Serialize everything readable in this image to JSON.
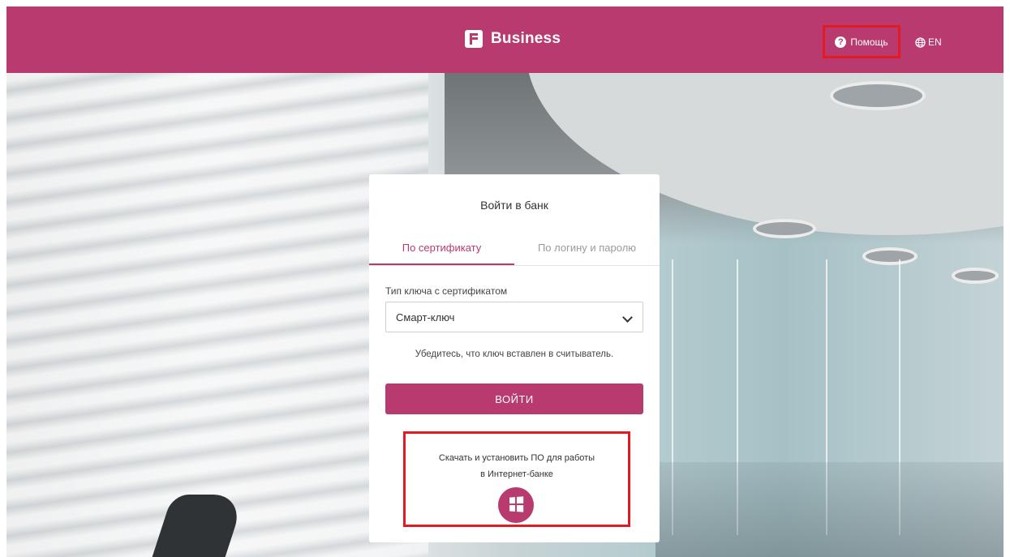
{
  "header": {
    "brand": "Business",
    "help_label": "Помощь",
    "lang_label": "EN"
  },
  "login": {
    "title": "Войти в банк",
    "tabs": [
      {
        "label": "По сертификату",
        "active": true
      },
      {
        "label": "По логину и паролю",
        "active": false
      }
    ],
    "key_type_label": "Тип ключа с сертификатом",
    "key_type_value": "Смарт-ключ",
    "hint": "Убедитесь, что ключ вставлен в считыватель.",
    "submit_label": "ВОЙТИ",
    "download_line1": "Скачать и установить ПО для работы",
    "download_line2": "в Интернет-банке"
  },
  "icons": {
    "logo": "brand-f-icon",
    "help": "question-circle-icon",
    "language": "globe-icon",
    "dropdown": "chevron-down-icon",
    "download": "windows-icon"
  },
  "colors": {
    "brand": "#b83a6e",
    "highlight": "#e21b23"
  }
}
